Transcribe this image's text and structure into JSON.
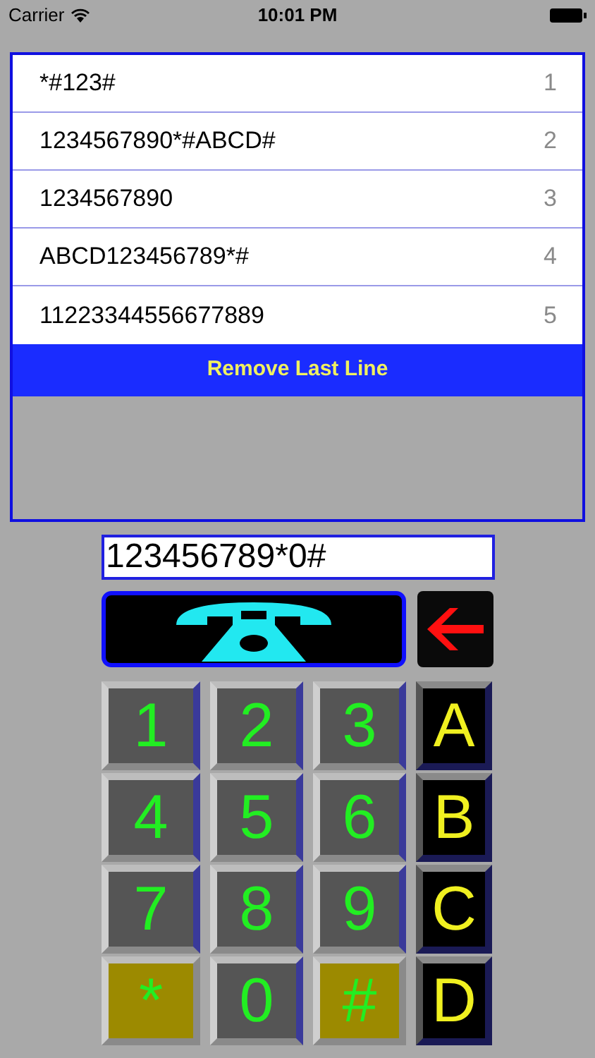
{
  "status_bar": {
    "carrier": "Carrier",
    "time": "10:01 PM"
  },
  "history": {
    "rows": [
      {
        "number": "*#123#",
        "index": "1"
      },
      {
        "number": "1234567890*#ABCD#",
        "index": "2"
      },
      {
        "number": "1234567890",
        "index": "3"
      },
      {
        "number": "ABCD123456789*#",
        "index": "4"
      },
      {
        "number": "11223344556677889",
        "index": "5"
      }
    ],
    "remove_button": "Remove Last Line"
  },
  "dial_field": {
    "value": "123456789*0#"
  },
  "keys": [
    {
      "label": "1",
      "kind": "digit"
    },
    {
      "label": "2",
      "kind": "digit"
    },
    {
      "label": "3",
      "kind": "digit"
    },
    {
      "label": "A",
      "kind": "letter"
    },
    {
      "label": "4",
      "kind": "digit"
    },
    {
      "label": "5",
      "kind": "digit"
    },
    {
      "label": "6",
      "kind": "digit"
    },
    {
      "label": "B",
      "kind": "letter"
    },
    {
      "label": "7",
      "kind": "digit"
    },
    {
      "label": "8",
      "kind": "digit"
    },
    {
      "label": "9",
      "kind": "digit"
    },
    {
      "label": "C",
      "kind": "letter"
    },
    {
      "label": "*",
      "kind": "symbol"
    },
    {
      "label": "0",
      "kind": "digit"
    },
    {
      "label": "#",
      "kind": "symbol"
    },
    {
      "label": "D",
      "kind": "letter"
    }
  ]
}
